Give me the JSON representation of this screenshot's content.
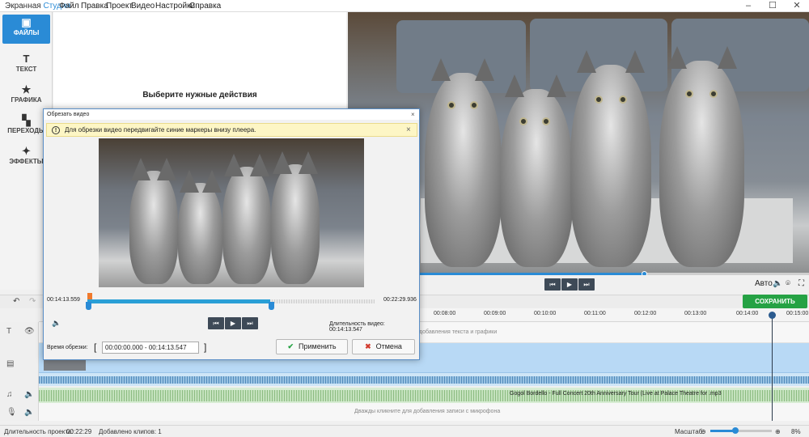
{
  "app": {
    "name_main": "Экранная ",
    "name_accent": "Студия",
    "menu": [
      "Файл",
      "Правка",
      "Проект",
      "Видео",
      "Настройки",
      "Справка"
    ],
    "window_controls": [
      "–",
      "☐",
      "✕"
    ]
  },
  "sidebar": {
    "items": [
      {
        "label": "ФАЙЛЫ",
        "icon": "files-icon",
        "glyph": "▣",
        "active": true
      },
      {
        "label": "ТЕКСТ",
        "icon": "text-icon",
        "glyph": "T",
        "active": false
      },
      {
        "label": "ГРАФИКА",
        "icon": "star-icon",
        "glyph": "★",
        "active": false
      },
      {
        "label": "ПЕРЕХОДЫ",
        "icon": "transitions-icon",
        "glyph": "▚",
        "active": false
      },
      {
        "label": "ЭФФЕКТЫ",
        "icon": "effects-icon",
        "glyph": "✦",
        "active": false
      }
    ]
  },
  "midpanel": {
    "hint": "Выберите нужные действия"
  },
  "player": {
    "auto_label": "Авто",
    "progress": 0.642
  },
  "toolbar": {
    "save_label": "СОХРАНИТЬ ВИДЕО"
  },
  "ruler": {
    "ticks": [
      "00:08:00",
      "00:09:00",
      "00:10:00",
      "00:11:00",
      "00:12:00",
      "00:13:00",
      "00:14:00",
      "00:15:00"
    ]
  },
  "tracks": {
    "text_hint": "добавления текста и графики",
    "music_label": "Gogol Bordello - Full Concert 20th Anniversary Tour (Live at Palace Theatre for .mp3",
    "mic_hint": "Дважды кликните для добавления записи с микрофона"
  },
  "status": {
    "duration_label": "Длительность проекта:",
    "duration_value": "00:22:29",
    "clips_label": "Добавлено клипов: 1",
    "zoom_label": "Масштаб:",
    "zoom_value": "8%"
  },
  "dialog": {
    "title": "Обрезать видео",
    "note": "Для обрезки видео передвигайте синие маркеры внизу плеера.",
    "start_time": "00:14:13.559",
    "end_time": "00:22:29.936",
    "duration_label": "Длительность видео: 00:14:13.547",
    "cut_time_label": "Время обрезки:",
    "range_value": "00:00:00.000 - 00:14:13.547",
    "apply_label": "Применить",
    "cancel_label": "Отмена",
    "selection_fraction": 0.637
  }
}
